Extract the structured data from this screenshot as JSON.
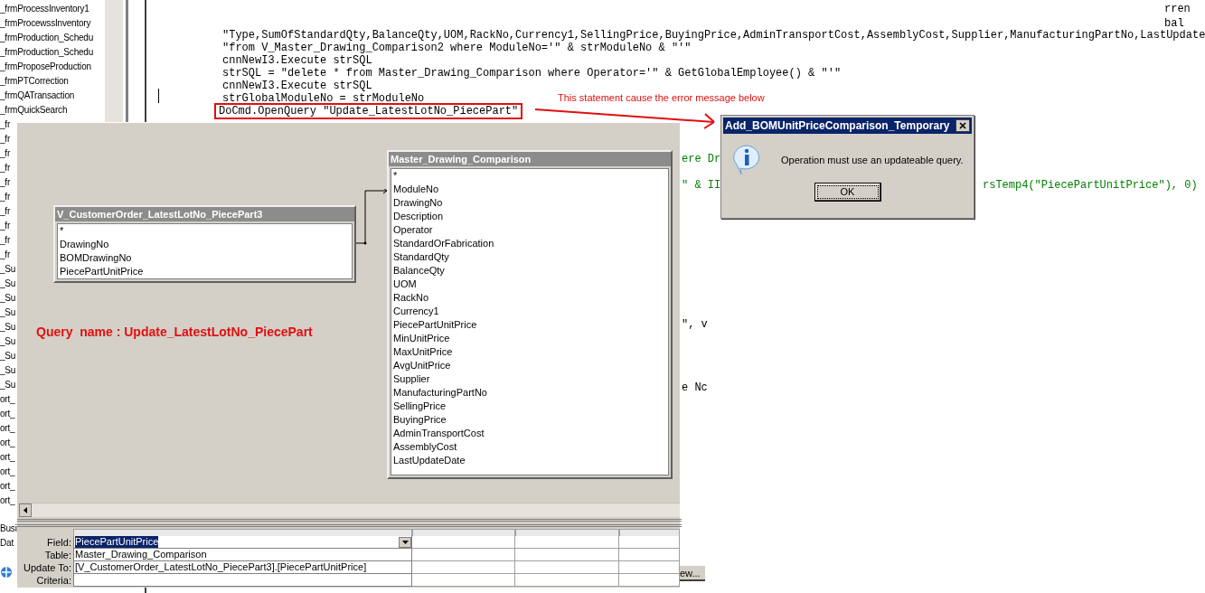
{
  "object_list": {
    "items": [
      "_frmProcessInventory1",
      "_frmProcewssInventory",
      "_frmProduction_Schedu",
      "_frmProduction_Schedu",
      "_frmProposeProduction",
      "_frmPTCorrection",
      "_frmQATransaction",
      "_frmQuickSearch",
      "_fr",
      "_fr",
      "_fr",
      "_fr",
      "_fr",
      "_fr",
      "_fr",
      "_fr",
      "_fr",
      "_fr",
      "_Su",
      "_Su",
      "_Su",
      "_Su",
      "_Su",
      "_Su",
      "_Su",
      "_Su",
      "_Su",
      "ort_",
      "ort_",
      "ort_",
      "ort_",
      "ort_",
      "ort_",
      "ort_",
      "ort_"
    ],
    "bottom_items": [
      "Busi",
      "Dat"
    ]
  },
  "code_editor": {
    "edge_fragments": [
      "rren",
      "bal"
    ],
    "lines": [
      {
        "text": "\"Type,SumOfStandardQty,BalanceQty,UOM,RackNo,Currency1,SellingPrice,BuyingPrice,AdminTransportCost,AssemblyCost,Supplier,ManufacturingPartNo,LastUpdate",
        "highlighted": false
      },
      {
        "text": "\"from V_Master_Drawing_Comparison2 where ModuleNo='\" & strModuleNo & \"'\"",
        "highlighted": false
      },
      {
        "text": "cnnNewI3.Execute strSQL",
        "highlighted": false
      },
      {
        "text": "strSQL = \"delete * from Master_Drawing_Comparison where Operator='\" & GetGlobalEmployee() & \"'\"",
        "highlighted": false
      },
      {
        "text": "cnnNewI3.Execute strSQL",
        "highlighted": false
      },
      {
        "text": "strGlobalModuleNo = strModuleNo",
        "highlighted": false
      },
      {
        "text": "DoCmd.OpenQuery \"Update_LatestLotNo_PiecePart\"",
        "highlighted": true
      }
    ],
    "annotation": "This statement cause the error message below",
    "visible_fragments": [
      {
        "kind": "comment",
        "text": "ere Dr"
      },
      {
        "kind": "comment",
        "text": "\" & II",
        "tail": "rsTemp4(\"PiecePartUnitPrice\"), 0)"
      },
      {
        "kind": "code",
        "text": "\", v"
      },
      {
        "kind": "code",
        "text": "e Nc"
      }
    ]
  },
  "query_window": {
    "tables": [
      {
        "title": "V_CustomerOrder_LatestLotNo_PiecePart3",
        "fields": [
          "*",
          "DrawingNo",
          "BOMDrawingNo",
          "PiecePartUnitPrice"
        ]
      },
      {
        "title": "Master_Drawing_Comparison",
        "fields": [
          "*",
          "ModuleNo",
          "DrawingNo",
          "Description",
          "Operator",
          "StandardOrFabrication",
          "StandardQty",
          "BalanceQty",
          "UOM",
          "RackNo",
          "Currency1",
          "PiecePartUnitPrice",
          "MinUnitPrice",
          "MaxUnitPrice",
          "AvgUnitPrice",
          "Supplier",
          "ManufacturingPartNo",
          "SellingPrice",
          "BuyingPrice",
          "AdminTransportCost",
          "AssemblyCost",
          "LastUpdateDate"
        ]
      }
    ],
    "query_name": "Query  name : Update_LatestLotNo_PiecePart",
    "grid": [
      {
        "label": "Field:",
        "value": "PiecePartUnitPrice",
        "selected": true
      },
      {
        "label": "Table:",
        "value": "Master_Drawing_Comparison",
        "selected": false
      },
      {
        "label": "Update To:",
        "value": "[V_CustomerOrder_LatestLotNo_PiecePart3].[PiecePartUnitPrice]",
        "selected": false
      },
      {
        "label": "Criteria:",
        "selected": false
      }
    ]
  },
  "side_button": "ew...",
  "dialog": {
    "title": "Add_BOMUnitPriceComparison_Temporary",
    "message": "Operation must use an updateable query.",
    "button": "OK"
  }
}
